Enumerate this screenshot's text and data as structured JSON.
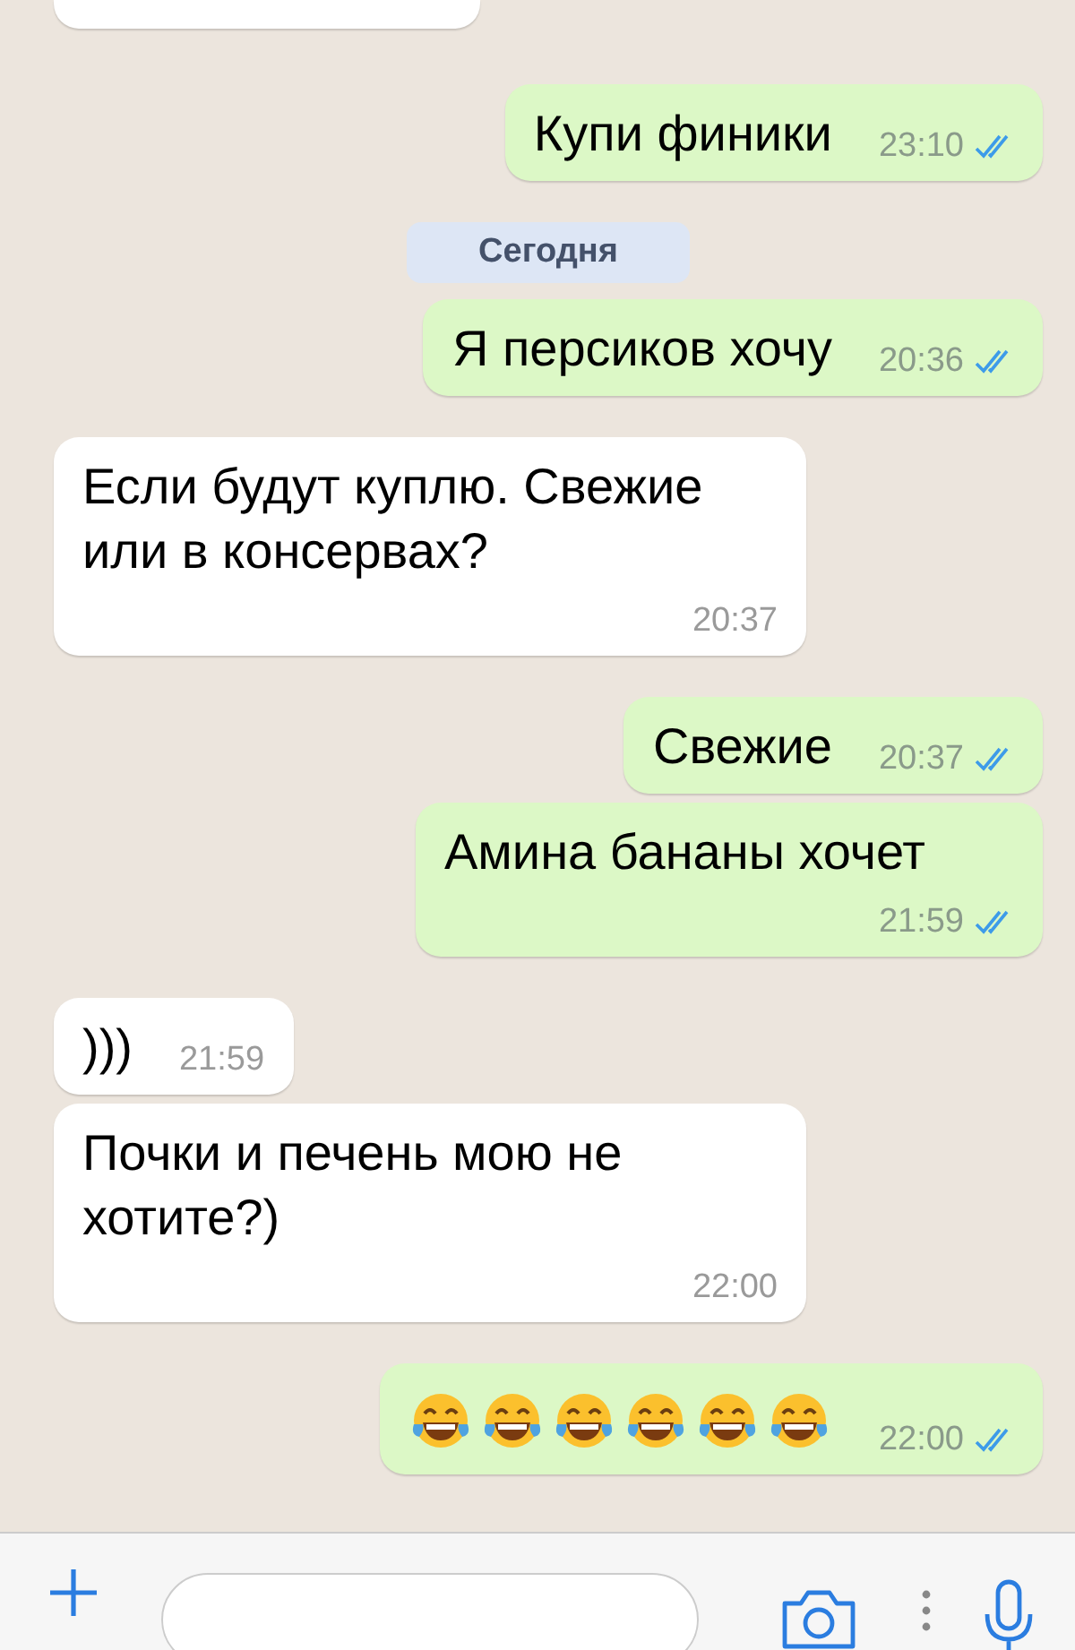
{
  "messages": [
    {
      "kind": "cut",
      "outgoing": false
    },
    {
      "kind": "text",
      "outgoing": true,
      "text": "Купи финики",
      "time": "23:10",
      "read": true
    },
    {
      "kind": "date",
      "text": "Сегодня"
    },
    {
      "kind": "text",
      "outgoing": true,
      "text": "Я персиков хочу",
      "time": "20:36",
      "read": true
    },
    {
      "kind": "text",
      "outgoing": false,
      "text": "Если будут куплю. Свежие или в консервах?",
      "time": "20:37"
    },
    {
      "kind": "text",
      "outgoing": true,
      "text": "Свежие",
      "time": "20:37",
      "read": true
    },
    {
      "kind": "text",
      "outgoing": true,
      "text": "Амина бананы хочет",
      "time": "21:59",
      "read": true
    },
    {
      "kind": "text",
      "outgoing": false,
      "text": ")))",
      "time": "21:59"
    },
    {
      "kind": "text",
      "outgoing": false,
      "text": "Почки и печень мою не хотите?)",
      "time": "22:00"
    },
    {
      "kind": "emoji",
      "outgoing": true,
      "emojis": [
        {
          "kind": "laughing-tears"
        },
        {
          "kind": "laughing-tears"
        },
        {
          "kind": "laughing-tears"
        },
        {
          "kind": "laughing-tears"
        },
        {
          "kind": "laughing-tears"
        },
        {
          "kind": "laughing-tears"
        }
      ],
      "time": "22:00",
      "read": true
    }
  ]
}
